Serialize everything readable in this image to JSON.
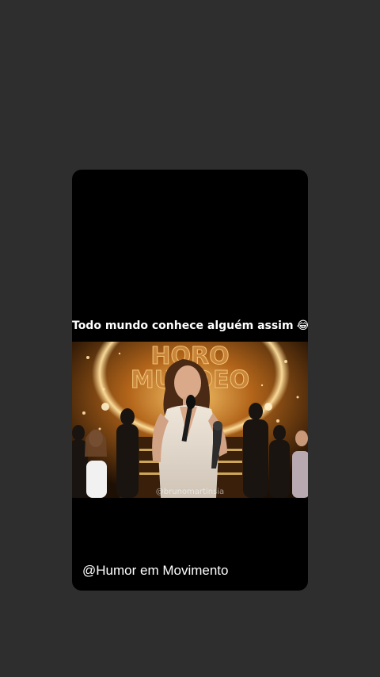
{
  "story": {
    "caption": "Todo mundo conhece alguém assim",
    "caption_emoji": "😂",
    "video": {
      "sign_text_line1": "HORO",
      "sign_text_line2": "MUNDEO",
      "watermark": "@brunomartinsia"
    },
    "handle": "@Humor em Movimento"
  },
  "colors": {
    "background": "#2f2e2e",
    "card": "#000000",
    "text": "#ffffff",
    "stage_gold": "#e0a342"
  }
}
